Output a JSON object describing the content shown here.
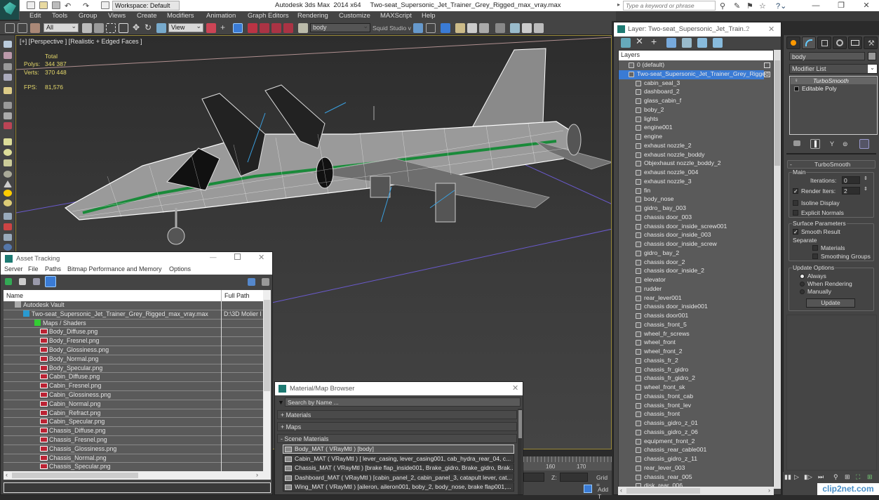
{
  "app": {
    "title": "Autodesk 3ds Max  2014 x64     Two-seat_Supersonic_Jet_Trainer_Grey_Rigged_max_vray.max",
    "workspace": "Workspace: Default",
    "search_placeholder": "Type a keyword or phrase",
    "window_buttons": {
      "minimize": "—",
      "restore": "❐",
      "close": "✕"
    }
  },
  "menu": [
    "Edit",
    "Tools",
    "Group",
    "Views",
    "Create",
    "Modifiers",
    "Animation",
    "Graph Editors",
    "Rendering",
    "Customize",
    "MAXScript",
    "Help"
  ],
  "toolbar": {
    "selection_filter": "All",
    "reference_coord": "View",
    "named_selection": "body",
    "squid_label": "Squid Studio v"
  },
  "viewport": {
    "label": "[+] [Perspective ] [Realistic + Edged Faces ]",
    "stats": {
      "total_label": "Total",
      "polys_label": "Polys:",
      "polys_value": "344 387",
      "verts_label": "Verts:",
      "verts_value": "370 448",
      "fps_label": "FPS:",
      "fps_value": "81,576"
    }
  },
  "layer_panel": {
    "title": "Layer: Two-seat_Supersonic_Jet_Train...",
    "help": "?",
    "close": "✕",
    "header": "Layers",
    "layers": [
      {
        "name": "0 (default)",
        "level": 0,
        "type": "layer"
      },
      {
        "name": "Two-seat_Supersonic_Jet_Trainer_Grey_Rigged",
        "level": 0,
        "type": "layer",
        "selected": true
      }
    ],
    "objects": [
      "cabin_seal_3",
      "dashboard_2",
      "glass_cabin_f",
      "boby_2",
      "lights",
      "engine001",
      "engine",
      "exhaust nozzle_2",
      "exhaust nozzle_boddy",
      "Objexhaust nozzle_boddy_2",
      "exhaust nozzle_004",
      "exhaust nozzle_3",
      "fin",
      "body_nose",
      "gidro_ bay_003",
      "chassis door_003",
      "chassis door_inside_screw001",
      "chassis door_inside_003",
      "chassis door_inside_screw",
      "gidro_ bay_2",
      "chassis door_2",
      "chassis door_inside_2",
      "elevator",
      "rudder",
      "rear_lever001",
      "chassis door_inside001",
      "chassis door001",
      "chassis_front_5",
      "wheel_fr_screws",
      "wheel_front",
      "wheel_front_2",
      "chassis_fr_2",
      "chassis_fr_gidro",
      "chassis_fr_gidro_2",
      "wheel_front_sk",
      "chassis_front_cab",
      "chassis_front_lev",
      "chassis_front",
      "chassis_gidro_z_01",
      "chassis_gidro_z_06",
      "equipment_front_2",
      "chassis_rear_cable001",
      "chassis_gidro_z_11",
      "rear_lever_003",
      "chassis_rear_005",
      "disk_rear_006"
    ]
  },
  "command_panel": {
    "object_name": "body",
    "modifier_list": "Modifier List",
    "stack": [
      {
        "name": "TurboSmooth",
        "active": true
      },
      {
        "name": "Editable Poly",
        "active": false
      }
    ],
    "turbosmooth": {
      "rollout_title": "TurboSmooth",
      "main_group": "Main",
      "iterations_label": "Iterations:",
      "iterations_value": "0",
      "render_iters_label": "Render Iters:",
      "render_iters_value": "2",
      "render_iters_checked": true,
      "isoline_label": "Isoline Display",
      "isoline_checked": false,
      "explicit_normals_label": "Explicit Normals",
      "explicit_normals_checked": false,
      "surface_group": "Surface Parameters",
      "smooth_result_label": "Smooth Result",
      "smooth_result_checked": true,
      "separate_label": "Separate",
      "materials_label": "Materials",
      "materials_checked": false,
      "smoothing_groups_label": "Smoothing Groups",
      "smoothing_groups_checked": false,
      "update_group": "Update Options",
      "update_options": [
        "Always",
        "When Rendering",
        "Manually"
      ],
      "update_selected": "Always",
      "update_button": "Update"
    }
  },
  "asset_tracking": {
    "title": "Asset Tracking",
    "menu": [
      "Server",
      "File",
      "Paths",
      "Bitmap Performance and Memory",
      "Options"
    ],
    "columns": [
      "Name",
      "Full Path"
    ],
    "rows": [
      {
        "name": "Autodesk Vault",
        "path": "",
        "level": 1,
        "icon": "vault"
      },
      {
        "name": "Two-seat_Supersonic_Jet_Trainer_Grey_Rigged_max_vray.max",
        "path": "D:\\3D Molier I",
        "level": 2,
        "icon": "max"
      },
      {
        "name": "Maps / Shaders",
        "path": "",
        "level": 3,
        "icon": "maps"
      },
      {
        "name": "Body_Diffuse.png",
        "path": "",
        "level": 4,
        "icon": "png"
      },
      {
        "name": "Body_Fresnel.png",
        "path": "",
        "level": 4,
        "icon": "png"
      },
      {
        "name": "Body_Glossiness.png",
        "path": "",
        "level": 4,
        "icon": "png"
      },
      {
        "name": "Body_Normal.png",
        "path": "",
        "level": 4,
        "icon": "png"
      },
      {
        "name": "Body_Specular.png",
        "path": "",
        "level": 4,
        "icon": "png"
      },
      {
        "name": "Cabin_Diffuse.png",
        "path": "",
        "level": 4,
        "icon": "png"
      },
      {
        "name": "Cabin_Fresnel.png",
        "path": "",
        "level": 4,
        "icon": "png"
      },
      {
        "name": "Cabin_Glossiness.png",
        "path": "",
        "level": 4,
        "icon": "png"
      },
      {
        "name": "Cabin_Normal.png",
        "path": "",
        "level": 4,
        "icon": "png"
      },
      {
        "name": "Cabin_Refract.png",
        "path": "",
        "level": 4,
        "icon": "png"
      },
      {
        "name": "Cabin_Specular.png",
        "path": "",
        "level": 4,
        "icon": "png"
      },
      {
        "name": "Chassis_Diffuse.png",
        "path": "",
        "level": 4,
        "icon": "png"
      },
      {
        "name": "Chassis_Fresnel.png",
        "path": "",
        "level": 4,
        "icon": "png"
      },
      {
        "name": "Chassis_Glossiness.png",
        "path": "",
        "level": 4,
        "icon": "png"
      },
      {
        "name": "Chassis_Normal.png",
        "path": "",
        "level": 4,
        "icon": "png"
      },
      {
        "name": "Chassis_Specular.png",
        "path": "",
        "level": 4,
        "icon": "png"
      }
    ]
  },
  "material_browser": {
    "title": "Material/Map Browser",
    "search_placeholder": "Search by Name ...",
    "sections": [
      "+ Materials",
      "+ Maps",
      "- Scene Materials"
    ],
    "scene_materials": [
      "Body_MAT  ( VRayMtl )  [body]",
      "Cabin_MAT  ( VRayMtl )  [ lever_casing,  lever_casing001, cab_hydra_rear_04, c...",
      "Chassis_MAT  ( VRayMtl )  [brake flap_inside001, Brake_gidro, Brake_gidro, Brak...",
      "Dashboard_MAT  ( VRayMtl )  [cabin_panel_2, cabin_panel_3, catapult lever, cat...",
      "Wing_MAT  ( VRayMtl )  [aileron, aileron001, boby_2, body_nose, brake flap001,..."
    ]
  },
  "timeline": {
    "ticks": [
      "160",
      "170"
    ],
    "z_label": "Z:",
    "grid_label": "Grid =",
    "add_time_tag": "Add T"
  },
  "watermark": "clip2net.com"
}
